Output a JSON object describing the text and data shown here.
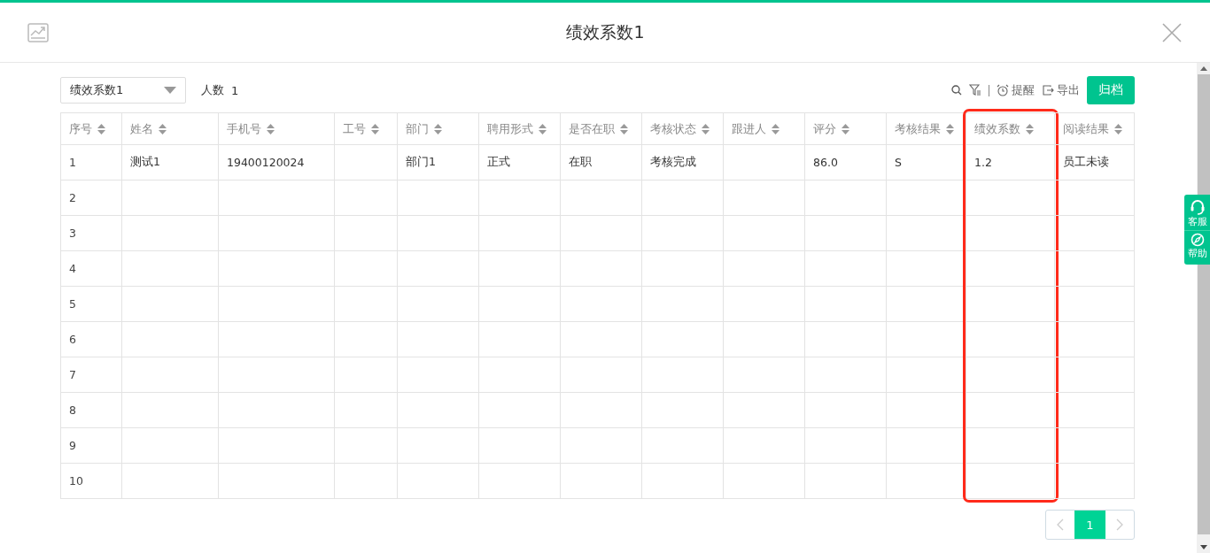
{
  "dialog": {
    "title": "绩效系数1"
  },
  "toolbar": {
    "select": {
      "value": "绩效系数1"
    },
    "count_label": "人数",
    "count": "1",
    "remind": "提醒",
    "export": "导出",
    "archive": "归档"
  },
  "table": {
    "columns": [
      {
        "label": "序号",
        "highlighted": false
      },
      {
        "label": "姓名",
        "highlighted": false
      },
      {
        "label": "手机号",
        "highlighted": false
      },
      {
        "label": "工号",
        "highlighted": false
      },
      {
        "label": "部门",
        "highlighted": false
      },
      {
        "label": "聘用形式",
        "highlighted": false
      },
      {
        "label": "是否在职",
        "highlighted": false
      },
      {
        "label": "考核状态",
        "highlighted": false
      },
      {
        "label": "跟进人",
        "highlighted": false
      },
      {
        "label": "评分",
        "highlighted": false
      },
      {
        "label": "考核结果",
        "highlighted": false
      },
      {
        "label": "绩效系数",
        "highlighted": true
      },
      {
        "label": "阅读结果",
        "highlighted": false
      }
    ],
    "rows": [
      {
        "cells": [
          "1",
          "测试1",
          "19400120024",
          null,
          "部门1",
          "正式",
          "在职",
          "考核完成",
          null,
          "86.0",
          "S",
          "1.2",
          "员工未读"
        ]
      },
      {
        "cells": [
          "2"
        ]
      },
      {
        "cells": [
          "3"
        ]
      },
      {
        "cells": [
          "4"
        ]
      },
      {
        "cells": [
          "5"
        ]
      },
      {
        "cells": [
          "6"
        ]
      },
      {
        "cells": [
          "7"
        ]
      },
      {
        "cells": [
          "8"
        ]
      },
      {
        "cells": [
          "9"
        ]
      },
      {
        "cells": [
          "10"
        ]
      }
    ]
  },
  "pagination": {
    "pages": [
      {
        "label": "1",
        "selected": true
      }
    ]
  },
  "side_widget": {
    "items": [
      {
        "kind": "support",
        "label": "客服"
      },
      {
        "kind": "help",
        "label": "帮助"
      }
    ]
  }
}
